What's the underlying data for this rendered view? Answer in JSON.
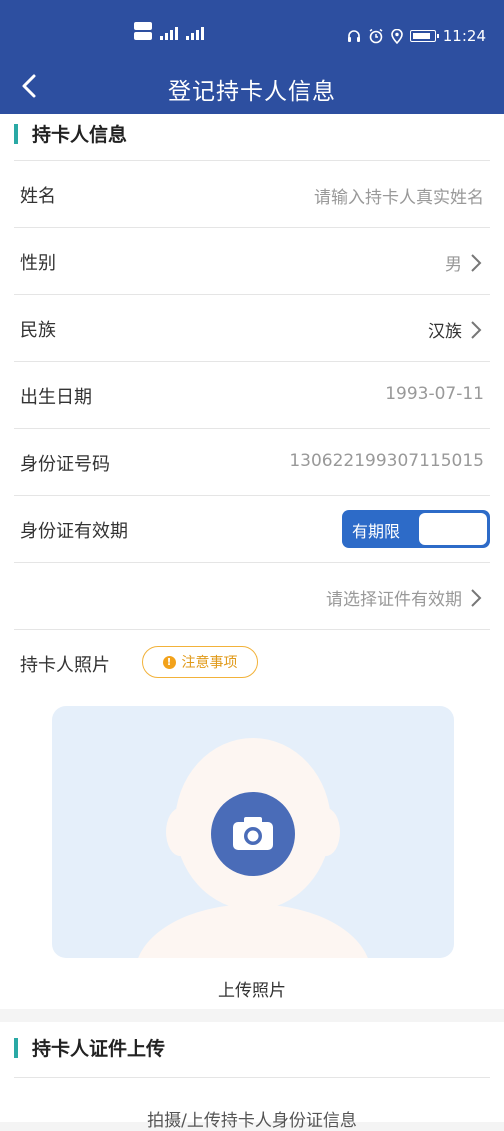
{
  "status_bar": {
    "time": "11:24"
  },
  "nav": {
    "title": "登记持卡人信息"
  },
  "section1": {
    "title": "持卡人信息"
  },
  "fields": {
    "name": {
      "label": "姓名",
      "placeholder": "请输入持卡人真实姓名"
    },
    "gender": {
      "label": "性别",
      "value": "男"
    },
    "ethnicity": {
      "label": "民族",
      "value": "汉族"
    },
    "birth": {
      "label": "出生日期",
      "value": "1993-07-11"
    },
    "id_number": {
      "label": "身份证号码",
      "value": "130622199307115015"
    },
    "id_validity": {
      "label": "身份证有效期",
      "toggle_label": "有期限"
    },
    "validity_select": {
      "placeholder": "请选择证件有效期"
    }
  },
  "photo": {
    "label": "持卡人照片",
    "notice": "注意事项",
    "upload_label": "上传照片"
  },
  "section2": {
    "title": "持卡人证件上传",
    "hint": "拍摄/上传持卡人身份证信息"
  },
  "colors": {
    "primary": "#2d4fa0",
    "toggle": "#2d6bc8",
    "accent": "#2aa9a5",
    "warning": "#f2b23a"
  }
}
